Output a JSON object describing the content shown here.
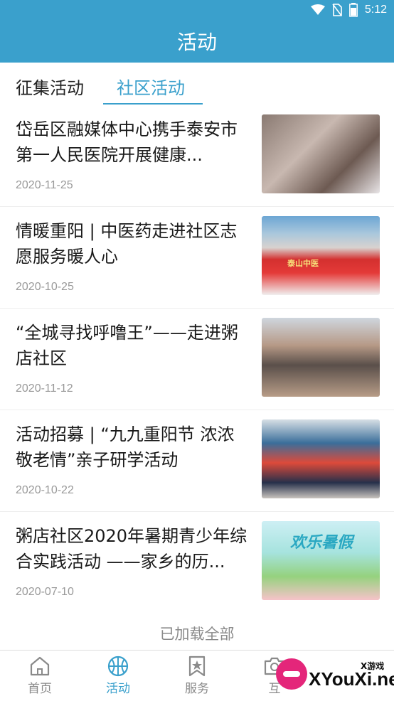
{
  "status_bar": {
    "time": "5:12",
    "icons": [
      "wifi-icon",
      "no-sim-icon",
      "battery-icon"
    ]
  },
  "header": {
    "title": "活动",
    "background": "#3aa0cc"
  },
  "tabs": [
    {
      "label": "征集活动",
      "active": false
    },
    {
      "label": "社区活动",
      "active": true
    }
  ],
  "items": [
    {
      "title": "岱岳区融媒体中心携手泰安市第一人民医院开展健康...",
      "date": "2020-11-25"
    },
    {
      "title": "情暖重阳 | 中医药走进社区志愿服务暖人心",
      "date": "2020-10-25",
      "thumb_caption": "泰山中医"
    },
    {
      "title": "“全城寻找呼噜王”——走进粥店社区",
      "date": "2020-11-12"
    },
    {
      "title": "活动招募 | “九九重阳节 浓浓敬老情”亲子研学活动",
      "date": "2020-10-22"
    },
    {
      "title": "粥店社区2020年暑期青少年综合实践活动 ——家乡的历...",
      "date": "2020-07-10",
      "thumb_caption": "欢乐暑假"
    }
  ],
  "footer_status": "已加载全部",
  "bottom_nav": [
    {
      "label": "首页",
      "icon": "home-icon",
      "active": false
    },
    {
      "label": "活动",
      "icon": "basketball-icon",
      "active": true
    },
    {
      "label": "服务",
      "icon": "bookmark-star-icon",
      "active": false
    },
    {
      "label": "互",
      "icon": "camera-icon",
      "active": false
    }
  ],
  "watermark": {
    "text": "XYouXi.net",
    "sub": "X游戏"
  },
  "colors": {
    "accent": "#3aa0cc",
    "text": "#1a1a1a",
    "muted": "#999999"
  }
}
